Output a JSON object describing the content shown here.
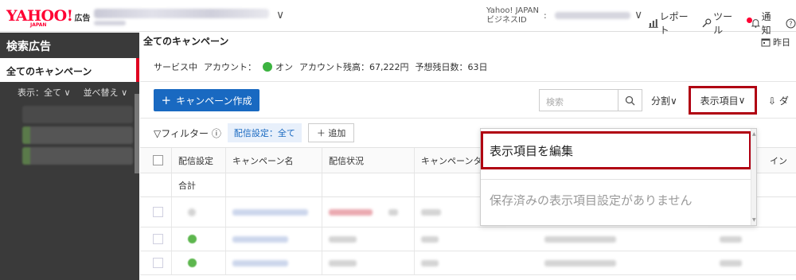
{
  "header": {
    "logo_text": "YAHOO!",
    "logo_sub": "JAPAN",
    "logo_suffix": "広告",
    "bizid_label_line1": "Yahoo! JAPAN",
    "bizid_label_line2": "ビジネスID",
    "bizid_colon": ":",
    "nav": {
      "report": "レポート",
      "tool": "ツール",
      "notice": "通知"
    }
  },
  "sidebar": {
    "title": "検索広告",
    "all_campaigns": "全てのキャンペーン",
    "display_filter": "表示：全て",
    "sort": "並べ替え"
  },
  "main": {
    "title": "全てのキャンペーン",
    "period_label": "昨日",
    "status": {
      "service_status": "サービス中",
      "account_label": "アカウント：",
      "account_state": "オン",
      "balance": "アカウント残高：67,222円",
      "days_left": "予想残日数：63日"
    },
    "toolbar": {
      "create_button": "キャンペーン作成",
      "search_placeholder": "検索",
      "split": "分割",
      "display_items": "表示項目",
      "download": "ダ"
    },
    "filter": {
      "label": "フィルター",
      "chip": "配信設定：全て",
      "add": "追加"
    },
    "table": {
      "columns": [
        "配信設定",
        "キャンペーン名",
        "配信状況",
        "キャンペーンタ",
        "イン"
      ],
      "total_label": "合計"
    }
  },
  "dropdown": {
    "edit_label": "表示項目を編集",
    "none_label": "保存済みの表示項目設定がありません"
  },
  "colors": {
    "brand_red": "#ff0033",
    "primary_blue": "#1969c1",
    "highlight_border": "#b00012",
    "status_green": "#3cb340",
    "sidebar_bg": "#3a3a3a"
  }
}
